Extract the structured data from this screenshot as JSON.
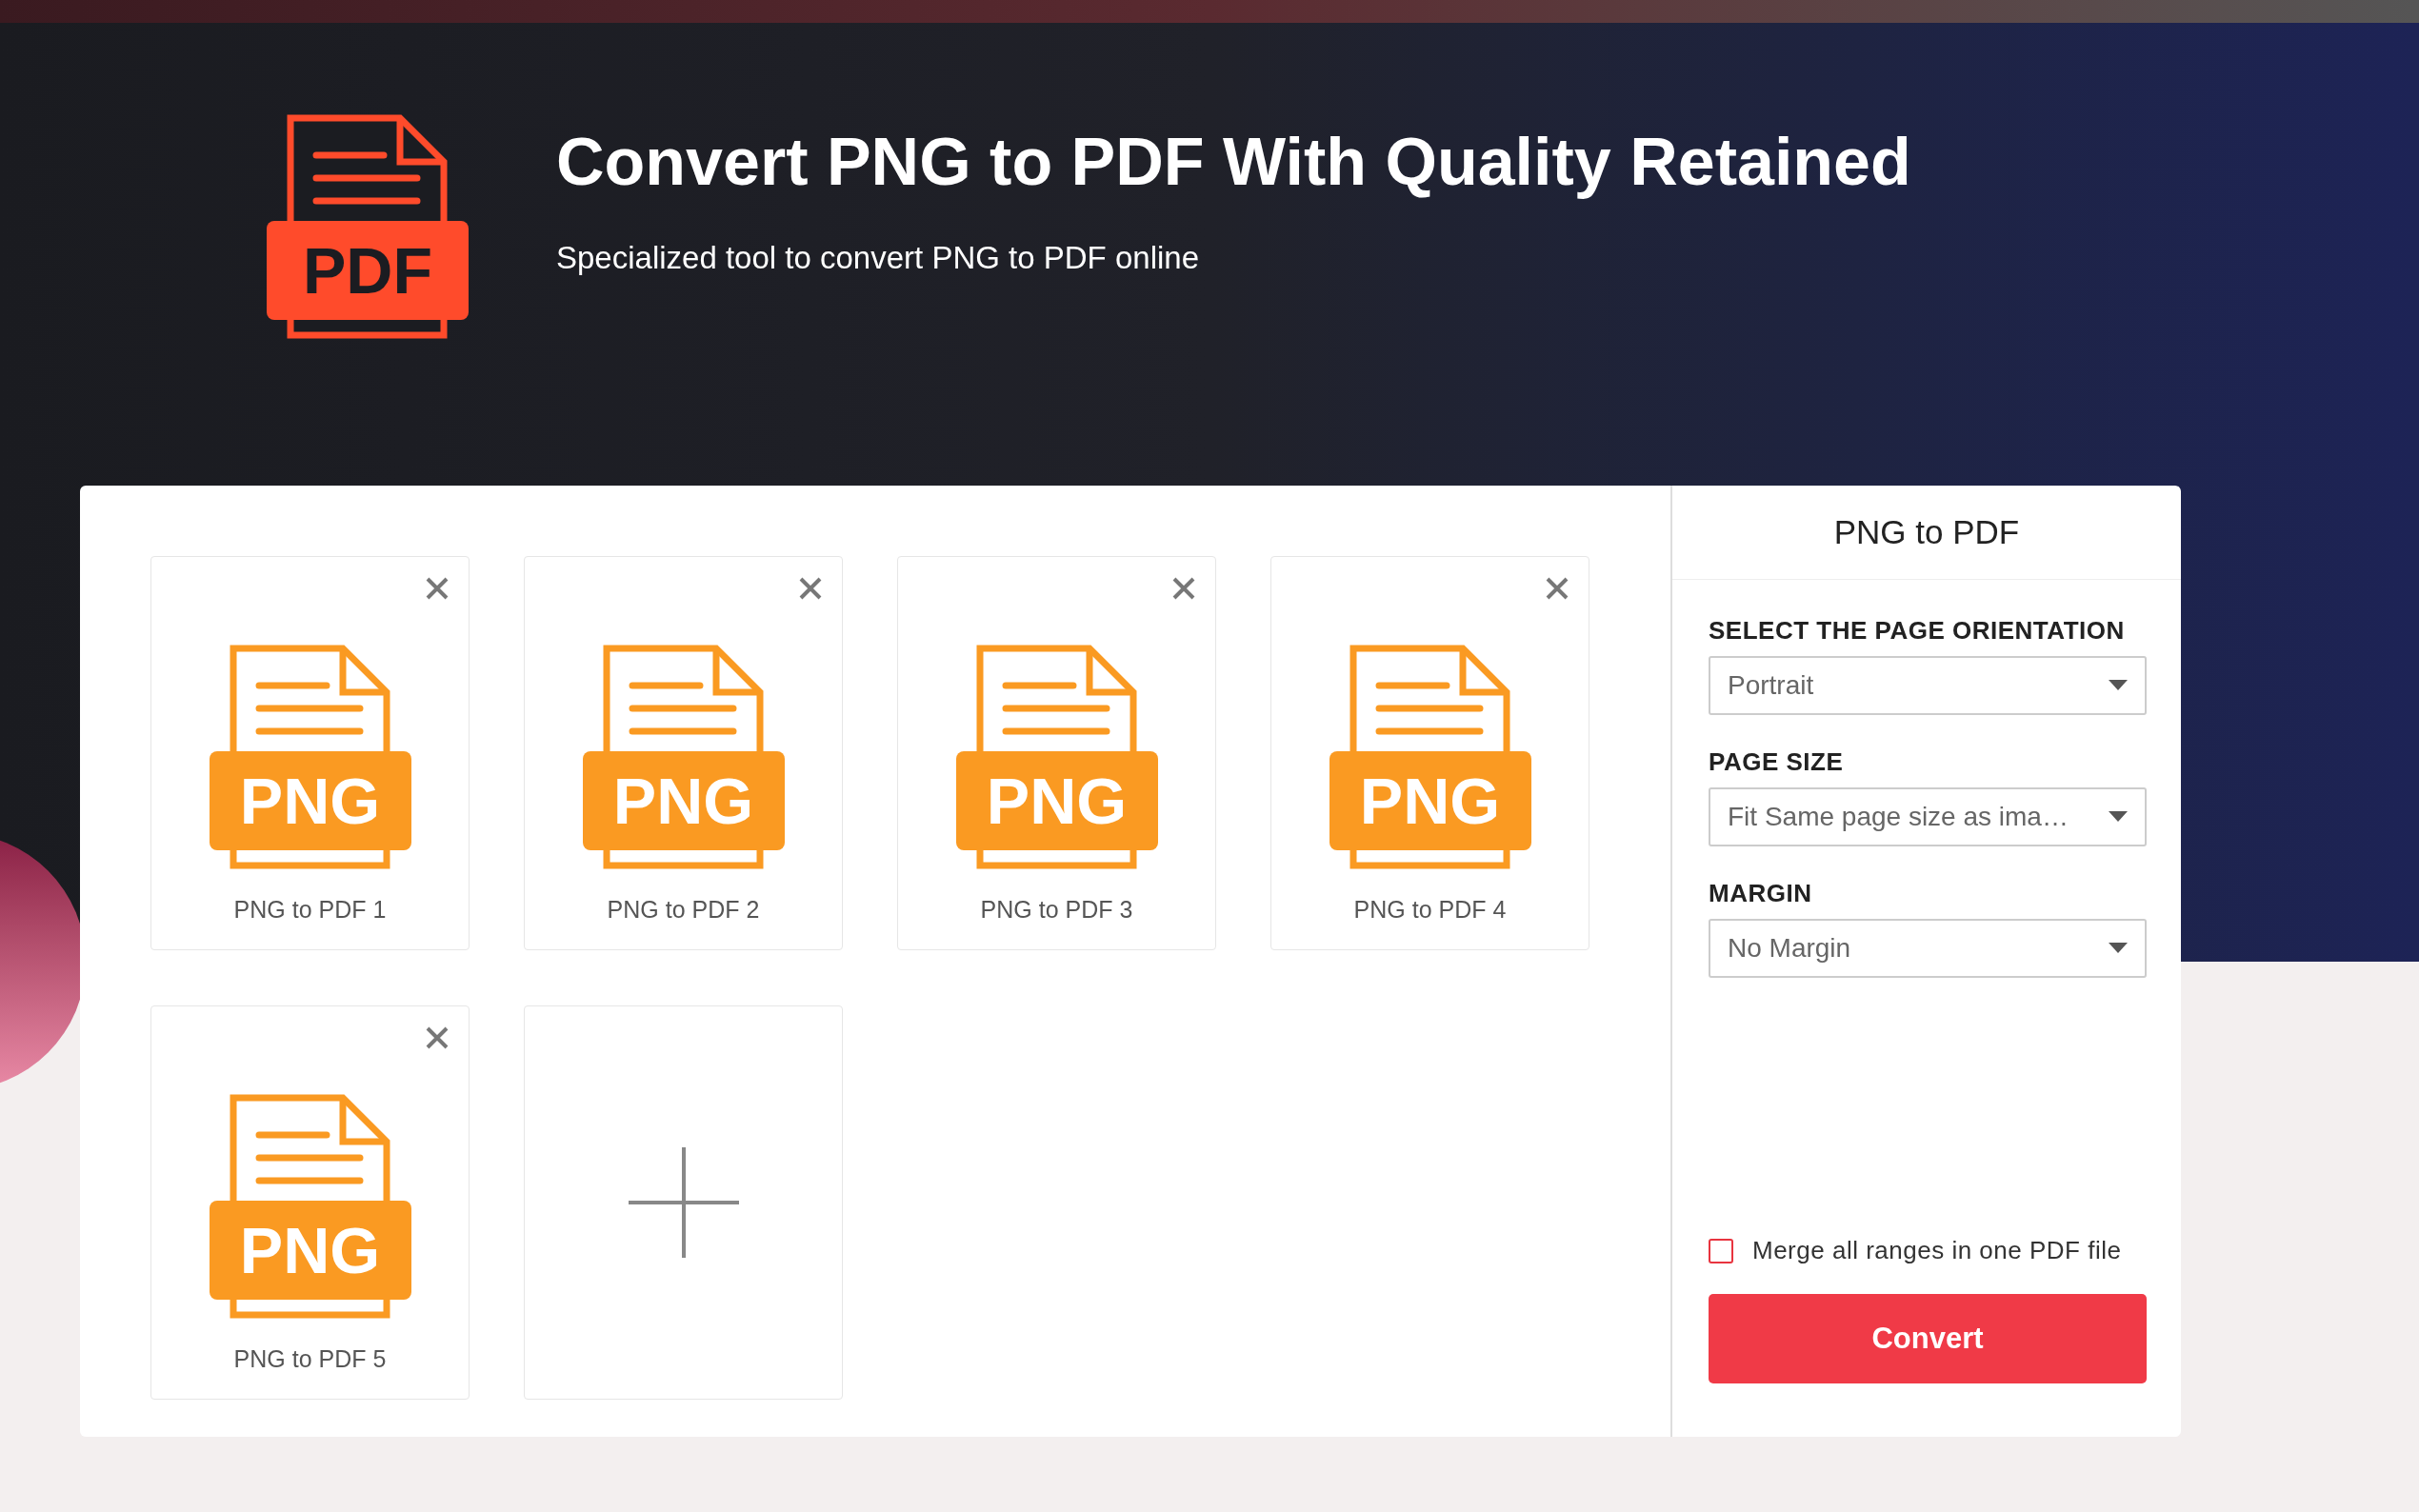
{
  "header": {
    "logo_label": "PDF",
    "title": "Convert PNG to PDF With Quality Retained",
    "subtitle": "Specialized tool to convert PNG to PDF online"
  },
  "files": [
    {
      "badge": "PNG",
      "name": "PNG to PDF 1"
    },
    {
      "badge": "PNG",
      "name": "PNG to PDF 2"
    },
    {
      "badge": "PNG",
      "name": "PNG to PDF 3"
    },
    {
      "badge": "PNG",
      "name": "PNG to PDF 4"
    },
    {
      "badge": "PNG",
      "name": "PNG to PDF 5"
    }
  ],
  "panel": {
    "title": "PNG to PDF",
    "settings": [
      {
        "label": "SELECT THE PAGE ORIENTATION",
        "value": "Portrait"
      },
      {
        "label": "PAGE SIZE",
        "value": "Fit Same page size as ima…"
      },
      {
        "label": "MARGIN",
        "value": "No Margin"
      }
    ],
    "merge": {
      "label": "Merge all ranges in one PDF file",
      "checked": false
    },
    "convert_button": "Convert"
  }
}
